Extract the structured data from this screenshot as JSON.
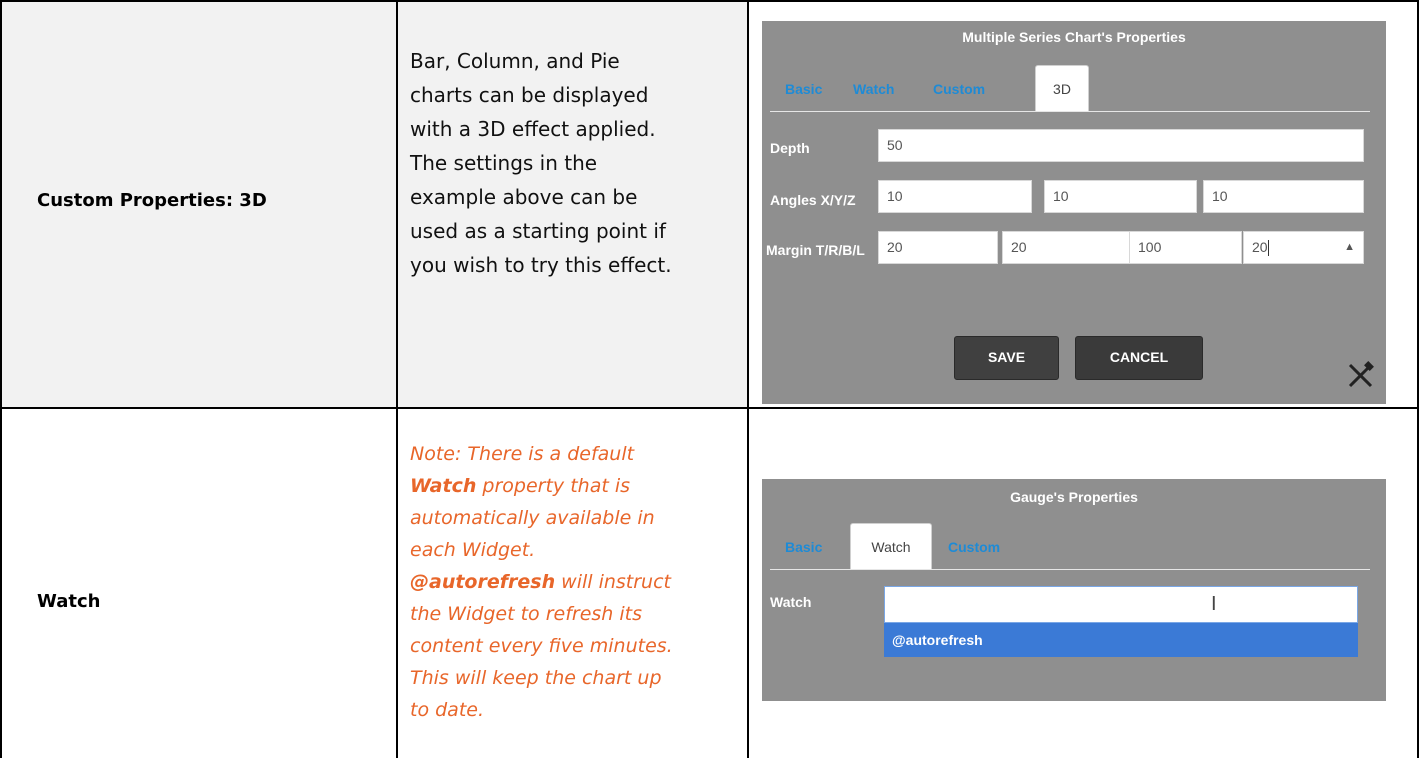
{
  "rows": [
    {
      "label": "Custom Properties: 3D",
      "description": [
        "Bar, Column, and Pie",
        "charts can be displayed",
        "with a 3D effect applied.",
        "The settings in the",
        "example above can be",
        "used as a starting point if",
        "you wish to try this effect."
      ]
    },
    {
      "label": "Watch",
      "note": {
        "line1": "Note: There is a default",
        "watch_bold": "Watch",
        "line2_rest": " property that is",
        "line3": "automatically available in",
        "line4": "each Widget.",
        "autorefresh_bold": "@autorefresh",
        "line5_rest": " will instruct",
        "line6": "the Widget to refresh its",
        "line7": "content every five minutes.",
        "line8": "This will keep the chart up",
        "line9": "to date."
      }
    }
  ],
  "dialog1": {
    "title": "Multiple Series Chart's Properties",
    "tabs": [
      "Basic",
      "Watch",
      "Custom",
      "3D"
    ],
    "active_tab": "3D",
    "depth_label": "Depth",
    "depth_value": "50",
    "angles_label": "Angles X/Y/Z",
    "angles": [
      "10",
      "10",
      "10"
    ],
    "margin_label": "Margin T/R/B/L",
    "margins": [
      "20",
      "20",
      "100",
      "20"
    ],
    "save_label": "SAVE",
    "cancel_label": "CANCEL",
    "tools_icon": "tools-icon"
  },
  "dialog2": {
    "title": "Gauge's Properties",
    "tabs": [
      "Basic",
      "Watch",
      "Custom"
    ],
    "active_tab": "Watch",
    "watch_label": "Watch",
    "watch_value": "",
    "suggestion": "@autorefresh"
  }
}
